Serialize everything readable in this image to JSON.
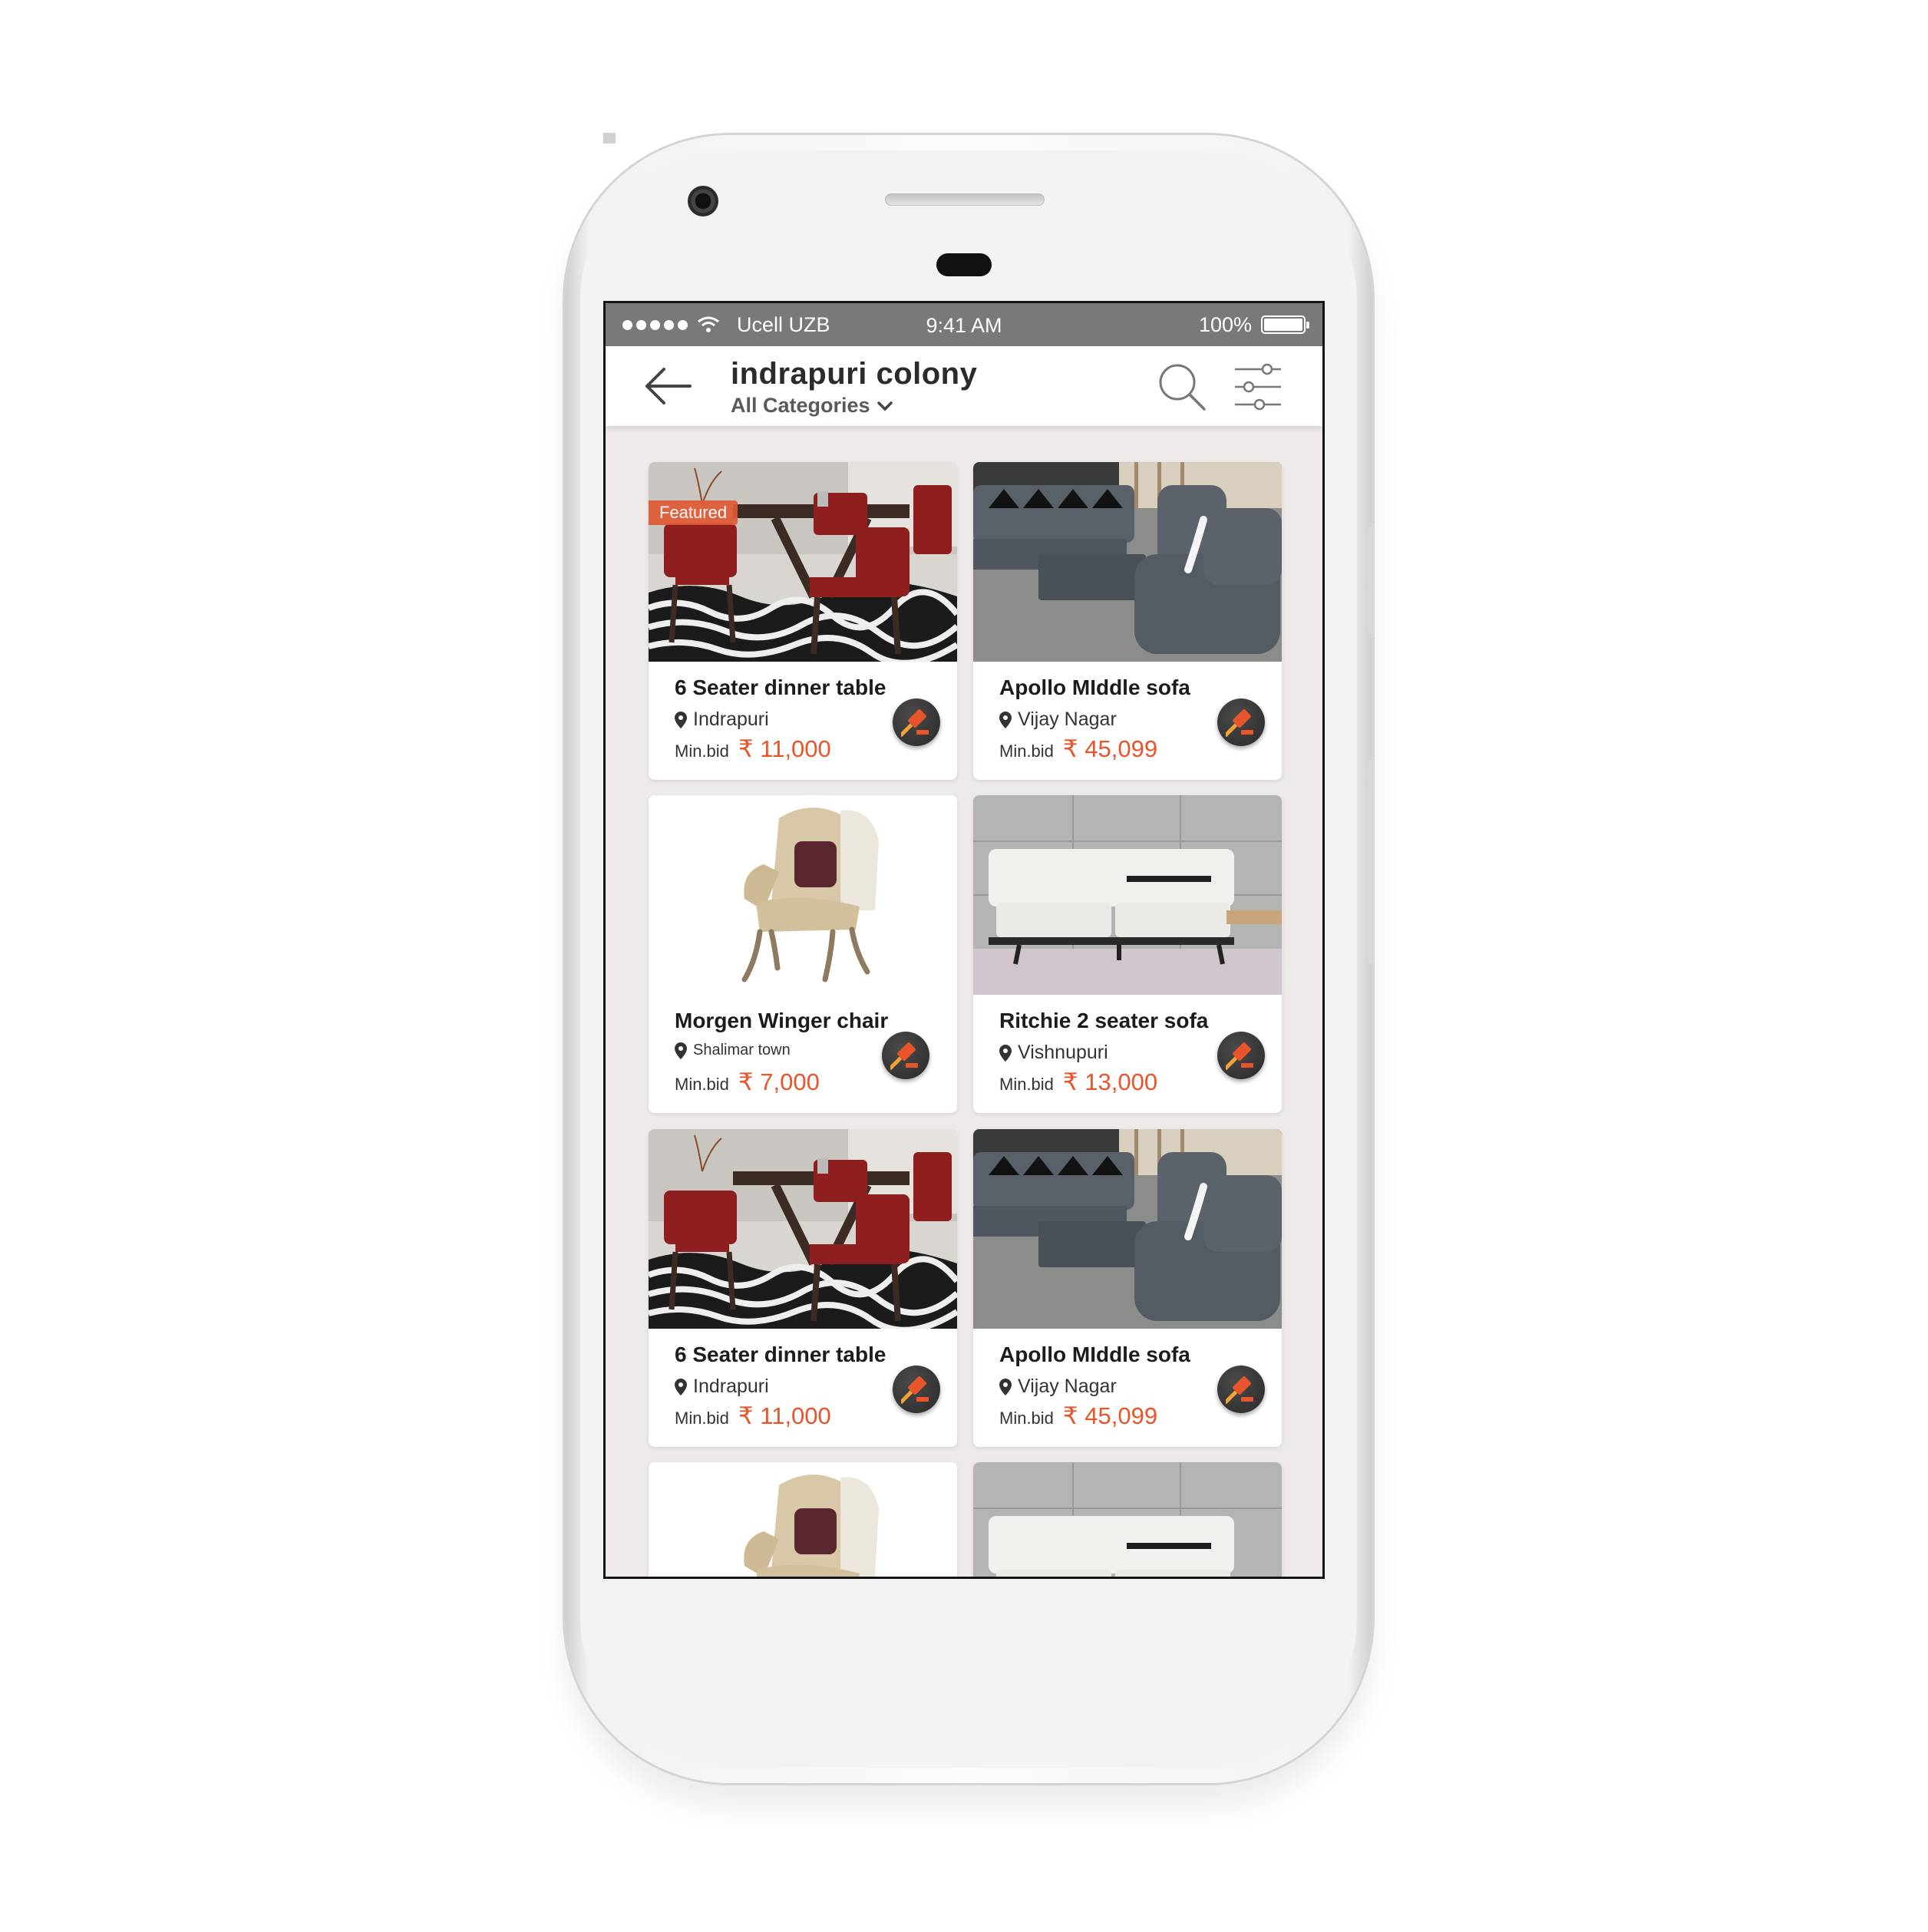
{
  "status_bar": {
    "carrier": "Ucell UZB",
    "time": "9:41 AM",
    "battery": "100%"
  },
  "header": {
    "title": "indrapuri colony",
    "category": "All Categories"
  },
  "colors": {
    "accent": "#e8552b",
    "status_bar": "#7a7878",
    "screen_background": "#efeaea"
  },
  "icons": [
    "back-arrow-icon",
    "search-icon",
    "filter-sliders-icon",
    "chevron-down-icon",
    "location-pin-icon",
    "gavel-icon"
  ],
  "listings": [
    {
      "title": "6 Seater dinner table",
      "featured": "Featured",
      "location": "Indrapuri",
      "min_bid_label": "Min.bid",
      "price": "₹ 11,000"
    },
    {
      "title": "Apollo MIddle sofa",
      "location": "Vijay Nagar",
      "min_bid_label": "Min.bid",
      "price": "₹ 45,099"
    },
    {
      "title": "Morgen Winger chair",
      "location": "Shalimar town",
      "min_bid_label": "Min.bid",
      "price": "₹ 7,000"
    },
    {
      "title": "Ritchie 2 seater sofa",
      "location": "Vishnupuri",
      "min_bid_label": "Min.bid",
      "price": "₹ 13,000"
    },
    {
      "title": "6 Seater dinner table",
      "location": "Indrapuri",
      "min_bid_label": "Min.bid",
      "price": "₹ 11,000"
    },
    {
      "title": "Apollo MIddle sofa",
      "location": "Vijay Nagar",
      "min_bid_label": "Min.bid",
      "price": "₹ 45,099"
    }
  ]
}
